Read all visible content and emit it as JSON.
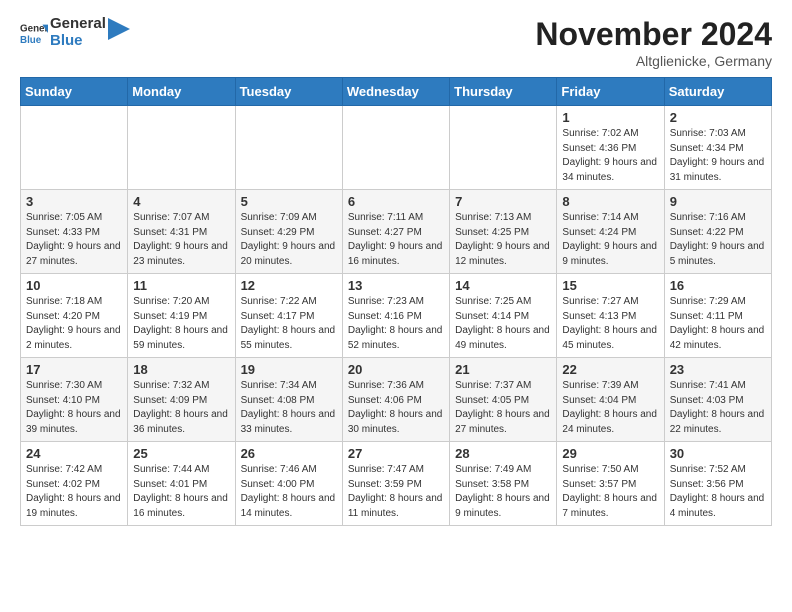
{
  "header": {
    "logo_line1": "General",
    "logo_line2": "Blue",
    "month": "November 2024",
    "location": "Altglienicke, Germany"
  },
  "days_of_week": [
    "Sunday",
    "Monday",
    "Tuesday",
    "Wednesday",
    "Thursday",
    "Friday",
    "Saturday"
  ],
  "weeks": [
    [
      {
        "day": "",
        "info": ""
      },
      {
        "day": "",
        "info": ""
      },
      {
        "day": "",
        "info": ""
      },
      {
        "day": "",
        "info": ""
      },
      {
        "day": "",
        "info": ""
      },
      {
        "day": "1",
        "info": "Sunrise: 7:02 AM\nSunset: 4:36 PM\nDaylight: 9 hours and 34 minutes."
      },
      {
        "day": "2",
        "info": "Sunrise: 7:03 AM\nSunset: 4:34 PM\nDaylight: 9 hours and 31 minutes."
      }
    ],
    [
      {
        "day": "3",
        "info": "Sunrise: 7:05 AM\nSunset: 4:33 PM\nDaylight: 9 hours and 27 minutes."
      },
      {
        "day": "4",
        "info": "Sunrise: 7:07 AM\nSunset: 4:31 PM\nDaylight: 9 hours and 23 minutes."
      },
      {
        "day": "5",
        "info": "Sunrise: 7:09 AM\nSunset: 4:29 PM\nDaylight: 9 hours and 20 minutes."
      },
      {
        "day": "6",
        "info": "Sunrise: 7:11 AM\nSunset: 4:27 PM\nDaylight: 9 hours and 16 minutes."
      },
      {
        "day": "7",
        "info": "Sunrise: 7:13 AM\nSunset: 4:25 PM\nDaylight: 9 hours and 12 minutes."
      },
      {
        "day": "8",
        "info": "Sunrise: 7:14 AM\nSunset: 4:24 PM\nDaylight: 9 hours and 9 minutes."
      },
      {
        "day": "9",
        "info": "Sunrise: 7:16 AM\nSunset: 4:22 PM\nDaylight: 9 hours and 5 minutes."
      }
    ],
    [
      {
        "day": "10",
        "info": "Sunrise: 7:18 AM\nSunset: 4:20 PM\nDaylight: 9 hours and 2 minutes."
      },
      {
        "day": "11",
        "info": "Sunrise: 7:20 AM\nSunset: 4:19 PM\nDaylight: 8 hours and 59 minutes."
      },
      {
        "day": "12",
        "info": "Sunrise: 7:22 AM\nSunset: 4:17 PM\nDaylight: 8 hours and 55 minutes."
      },
      {
        "day": "13",
        "info": "Sunrise: 7:23 AM\nSunset: 4:16 PM\nDaylight: 8 hours and 52 minutes."
      },
      {
        "day": "14",
        "info": "Sunrise: 7:25 AM\nSunset: 4:14 PM\nDaylight: 8 hours and 49 minutes."
      },
      {
        "day": "15",
        "info": "Sunrise: 7:27 AM\nSunset: 4:13 PM\nDaylight: 8 hours and 45 minutes."
      },
      {
        "day": "16",
        "info": "Sunrise: 7:29 AM\nSunset: 4:11 PM\nDaylight: 8 hours and 42 minutes."
      }
    ],
    [
      {
        "day": "17",
        "info": "Sunrise: 7:30 AM\nSunset: 4:10 PM\nDaylight: 8 hours and 39 minutes."
      },
      {
        "day": "18",
        "info": "Sunrise: 7:32 AM\nSunset: 4:09 PM\nDaylight: 8 hours and 36 minutes."
      },
      {
        "day": "19",
        "info": "Sunrise: 7:34 AM\nSunset: 4:08 PM\nDaylight: 8 hours and 33 minutes."
      },
      {
        "day": "20",
        "info": "Sunrise: 7:36 AM\nSunset: 4:06 PM\nDaylight: 8 hours and 30 minutes."
      },
      {
        "day": "21",
        "info": "Sunrise: 7:37 AM\nSunset: 4:05 PM\nDaylight: 8 hours and 27 minutes."
      },
      {
        "day": "22",
        "info": "Sunrise: 7:39 AM\nSunset: 4:04 PM\nDaylight: 8 hours and 24 minutes."
      },
      {
        "day": "23",
        "info": "Sunrise: 7:41 AM\nSunset: 4:03 PM\nDaylight: 8 hours and 22 minutes."
      }
    ],
    [
      {
        "day": "24",
        "info": "Sunrise: 7:42 AM\nSunset: 4:02 PM\nDaylight: 8 hours and 19 minutes."
      },
      {
        "day": "25",
        "info": "Sunrise: 7:44 AM\nSunset: 4:01 PM\nDaylight: 8 hours and 16 minutes."
      },
      {
        "day": "26",
        "info": "Sunrise: 7:46 AM\nSunset: 4:00 PM\nDaylight: 8 hours and 14 minutes."
      },
      {
        "day": "27",
        "info": "Sunrise: 7:47 AM\nSunset: 3:59 PM\nDaylight: 8 hours and 11 minutes."
      },
      {
        "day": "28",
        "info": "Sunrise: 7:49 AM\nSunset: 3:58 PM\nDaylight: 8 hours and 9 minutes."
      },
      {
        "day": "29",
        "info": "Sunrise: 7:50 AM\nSunset: 3:57 PM\nDaylight: 8 hours and 7 minutes."
      },
      {
        "day": "30",
        "info": "Sunrise: 7:52 AM\nSunset: 3:56 PM\nDaylight: 8 hours and 4 minutes."
      }
    ]
  ]
}
